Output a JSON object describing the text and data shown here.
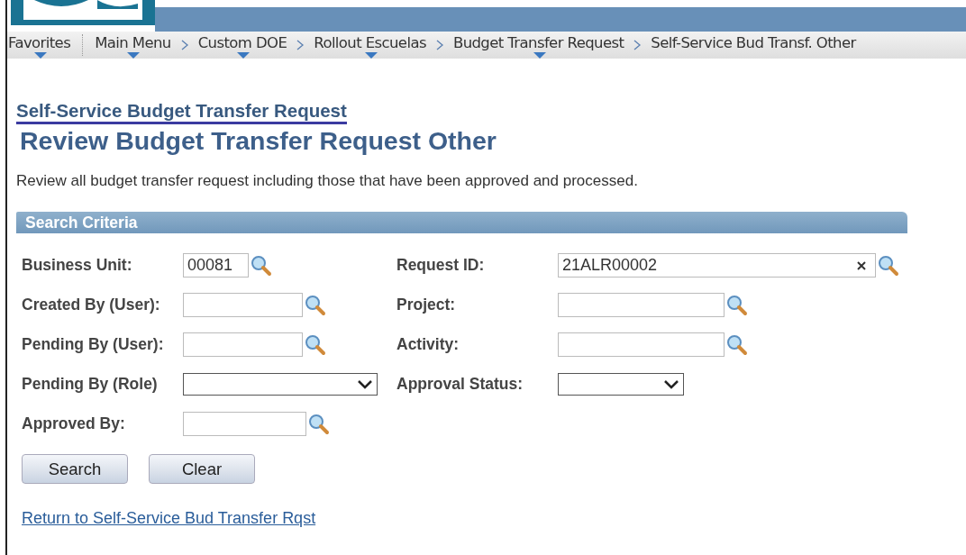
{
  "breadcrumbs": [
    {
      "label": "Favorites",
      "menu": true
    },
    {
      "label": "Main Menu",
      "menu": true
    },
    {
      "label": "Custom DOE",
      "menu": true
    },
    {
      "label": "Rollout Escuelas",
      "menu": true
    },
    {
      "label": "Budget Transfer Request",
      "menu": true
    },
    {
      "label": "Self-Service Bud Transf. Other",
      "menu": false
    }
  ],
  "page": {
    "parent_link": "Self-Service Budget Transfer Request",
    "title": "Review Budget Transfer Request Other",
    "description": "Review all budget transfer request including those that have been approved and processed."
  },
  "search_criteria": {
    "title": "Search Criteria",
    "rows": [
      [
        {
          "label": "Business Unit:",
          "kind": "lookup",
          "value": "00081"
        },
        {
          "label": "Request ID:",
          "kind": "lookup",
          "value": "21ALR00002",
          "clearable": true
        }
      ],
      [
        {
          "label": "Created By (User):",
          "kind": "lookup"
        },
        {
          "label": "Project:",
          "kind": "lookup"
        }
      ],
      [
        {
          "label": "Pending By (User):",
          "kind": "lookup"
        },
        {
          "label": "Activity:",
          "kind": "lookup"
        }
      ],
      [
        {
          "label": "Pending By (Role)",
          "kind": "select"
        },
        {
          "label": "Approval Status:",
          "kind": "select"
        }
      ],
      [
        {
          "label": "Approved By:",
          "kind": "lookup"
        }
      ]
    ]
  },
  "buttons": [
    "Search",
    "Clear"
  ],
  "return_link": "Return to Self-Service Bud Transfer Rqst"
}
